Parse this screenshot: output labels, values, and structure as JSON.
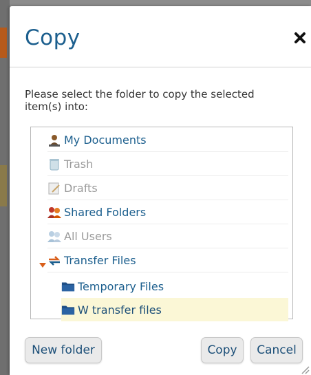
{
  "dialog": {
    "title": "Copy",
    "close_icon": "close-icon",
    "instruction": "Please select the folder to copy the selected item(s) into:"
  },
  "tree": {
    "items": [
      {
        "label": "My Documents",
        "icon": "user-icon",
        "state": "enabled"
      },
      {
        "label": "Trash",
        "icon": "trash-icon",
        "state": "disabled"
      },
      {
        "label": "Drafts",
        "icon": "drafts-icon",
        "state": "disabled"
      },
      {
        "label": "Shared Folders",
        "icon": "shared-users-icon",
        "state": "enabled"
      },
      {
        "label": "All Users",
        "icon": "users-icon",
        "state": "disabled"
      },
      {
        "label": "Transfer Files",
        "icon": "transfer-icon",
        "state": "expanded"
      },
      {
        "label": "Temporary Files",
        "icon": "folder-icon",
        "state": "enabled"
      },
      {
        "label": "W transfer files",
        "icon": "folder-icon",
        "state": "selected"
      }
    ]
  },
  "buttons": {
    "new_folder": "New folder",
    "copy": "Copy",
    "cancel": "Cancel"
  },
  "colors": {
    "title": "#1c5f8e",
    "link": "#1c5f8e",
    "disabled": "#9a9a9a",
    "selected_row": "#fbf7d6",
    "accent_orange": "#d95f1a"
  }
}
